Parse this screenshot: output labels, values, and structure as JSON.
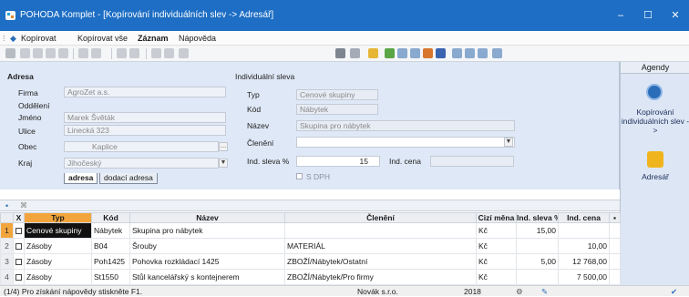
{
  "window": {
    "title": "POHODA Komplet - [Kopírování individuálních slev -> Adresář]"
  },
  "menu": {
    "copy": "Kopírovat",
    "copy_all": "Kopírovat vše",
    "record": "Záznam",
    "help": "Nápověda"
  },
  "adresa": {
    "section": "Adresa",
    "firma_label": "Firma",
    "firma": "AgroZet a.s.",
    "oddeleni_label": "Oddělení",
    "oddeleni": "",
    "jmeno_label": "Jméno",
    "jmeno": "Marek Švěták",
    "ulice_label": "Ulice",
    "ulice": "Linecká 323",
    "obec_label": "Obec",
    "obec": "Kaplice",
    "kraj_label": "Kraj",
    "kraj": "Jihočeský",
    "tab_adresa": "adresa",
    "tab_dodaci": "dodací adresa"
  },
  "sleva": {
    "section": "Individuální sleva",
    "typ_label": "Typ",
    "typ": "Cenové skupiny",
    "kod_label": "Kód",
    "kod": "Nábytek",
    "nazev_label": "Název",
    "nazev": "Skupina pro nábytek",
    "cleneni_label": "Členění",
    "cleneni": "",
    "ind_sleva_label": "Ind. sleva %",
    "ind_sleva": "15",
    "ind_cena_label": "Ind. cena",
    "ind_cena": "",
    "sdph_label": "S DPH"
  },
  "agenda": {
    "header": "Agendy",
    "item1": "Kopírování individuálních slev ->",
    "item2": "Adresář"
  },
  "grid": {
    "columns": [
      "",
      "X",
      "Typ",
      "Kód",
      "Název",
      "Členění",
      "Cizí měna",
      "Ind. sleva %",
      "Ind. cena"
    ],
    "rows": [
      {
        "n": "1",
        "typ": "Cenové skupiny",
        "kod": "Nábytek",
        "nazev": "Skupina pro nábytek",
        "cleneni": "",
        "mena": "Kč",
        "sleva": "15,00",
        "cena": ""
      },
      {
        "n": "2",
        "typ": "Zásoby",
        "kod": "B04",
        "nazev": "Šrouby",
        "cleneni": "MATERIÁL",
        "mena": "Kč",
        "sleva": "",
        "cena": "10,00"
      },
      {
        "n": "3",
        "typ": "Zásoby",
        "kod": "Poh1425",
        "nazev": "Pohovka rozkládací 1425",
        "cleneni": "ZBOŽÍ/Nábytek/Ostatní",
        "mena": "Kč",
        "sleva": "5,00",
        "cena": "12 768,00"
      },
      {
        "n": "4",
        "typ": "Zásoby",
        "kod": "St1550",
        "nazev": "Stůl kancelářský s kontejnerem",
        "cleneni": "ZBOŽÍ/Nábytek/Pro firmy",
        "mena": "Kč",
        "sleva": "",
        "cena": "7 500,00"
      }
    ]
  },
  "status": {
    "info": "(1/4) Pro získání nápovědy stiskněte F1.",
    "company": "Novák s.r.o.",
    "year": "2018"
  },
  "colors": {
    "titlebar": "#1d6ec4",
    "panel": "#dfe8f6",
    "selected": "#f2a53c"
  }
}
